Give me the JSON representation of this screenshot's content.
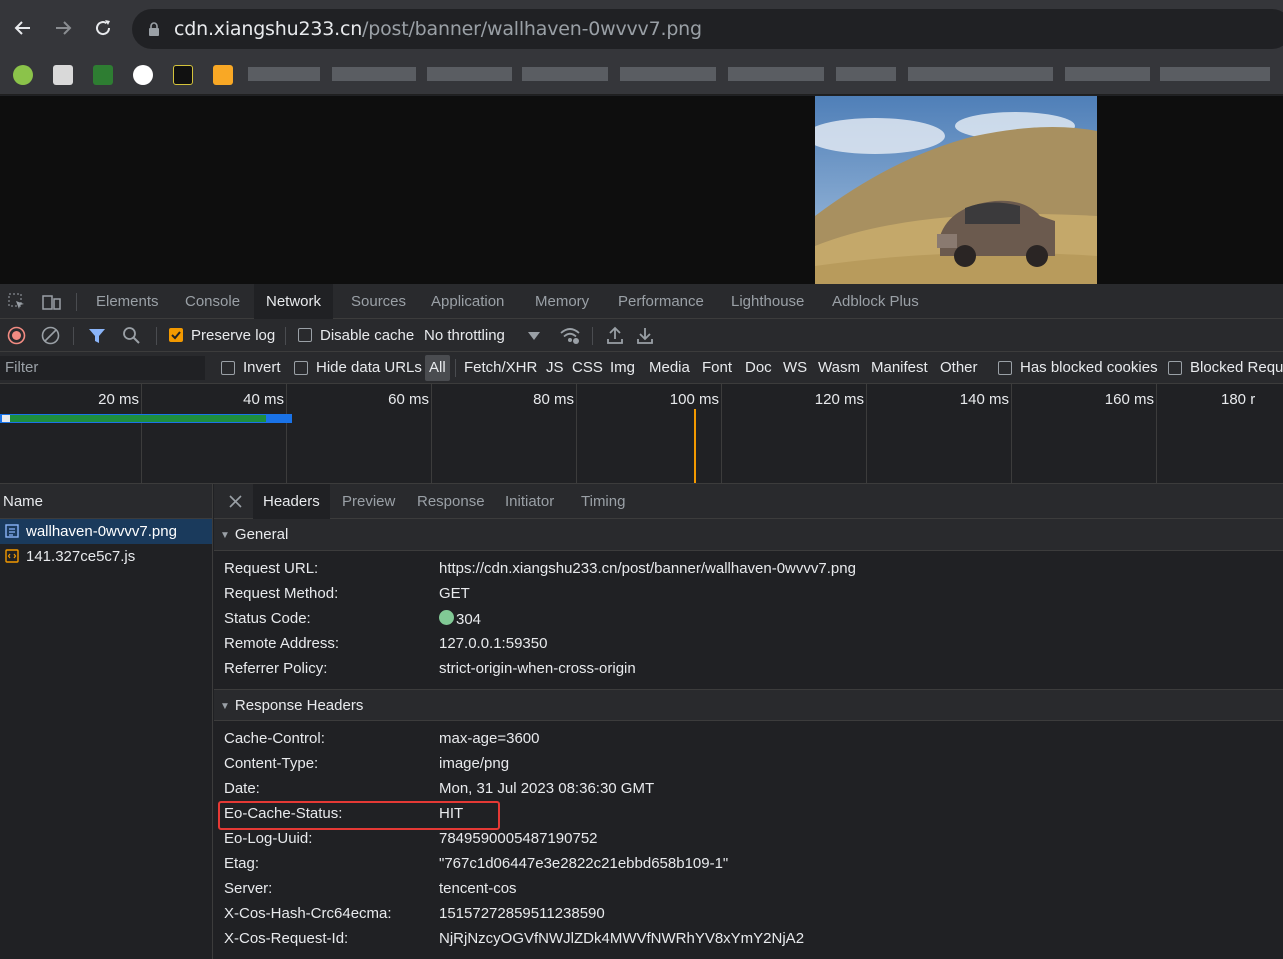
{
  "browser": {
    "url_host": "cdn.xiangshu233.cn",
    "url_path": "/post/banner/wallhaven-0wvvv7.png",
    "nav": {
      "back_icon": "back-arrow-icon",
      "forward_icon": "forward-arrow-icon",
      "reload_icon": "reload-icon"
    }
  },
  "devtools": {
    "tabs": [
      "Elements",
      "Console",
      "Network",
      "Sources",
      "Application",
      "Memory",
      "Performance",
      "Lighthouse",
      "Adblock Plus"
    ],
    "active_tab": "Network",
    "toolbar": {
      "preserve_log": "Preserve log",
      "disable_cache": "Disable cache",
      "throttling": "No throttling"
    },
    "filter": {
      "placeholder": "Filter",
      "invert": "Invert",
      "hide_data_urls": "Hide data URLs",
      "types": [
        "All",
        "Fetch/XHR",
        "JS",
        "CSS",
        "Img",
        "Media",
        "Font",
        "Doc",
        "WS",
        "Wasm",
        "Manifest",
        "Other"
      ],
      "has_blocked_cookies": "Has blocked cookies",
      "blocked_requests": "Blocked Reque"
    },
    "timeline": {
      "labels": [
        "20 ms",
        "40 ms",
        "60 ms",
        "80 ms",
        "100 ms",
        "120 ms",
        "140 ms",
        "160 ms",
        "180 r"
      ]
    },
    "requests": {
      "header": "Name",
      "items": [
        "wallhaven-0wvvv7.png",
        "141.327ce5c7.js"
      ]
    },
    "detail": {
      "tabs": [
        "Headers",
        "Preview",
        "Response",
        "Initiator",
        "Timing"
      ],
      "active_tab": "Headers",
      "general_title": "General",
      "general": {
        "request_url_k": "Request URL:",
        "request_url_v": "https://cdn.xiangshu233.cn/post/banner/wallhaven-0wvvv7.png",
        "method_k": "Request Method:",
        "method_v": "GET",
        "status_k": "Status Code:",
        "status_v": "304",
        "remote_k": "Remote Address:",
        "remote_v": "127.0.0.1:59350",
        "referrer_k": "Referrer Policy:",
        "referrer_v": "strict-origin-when-cross-origin"
      },
      "response_title": "Response Headers",
      "response": [
        {
          "k": "Cache-Control:",
          "v": "max-age=3600"
        },
        {
          "k": "Content-Type:",
          "v": "image/png"
        },
        {
          "k": "Date:",
          "v": "Mon, 31 Jul 2023 08:36:30 GMT"
        },
        {
          "k": "Eo-Cache-Status:",
          "v": "HIT"
        },
        {
          "k": "Eo-Log-Uuid:",
          "v": "7849590005487190752"
        },
        {
          "k": "Etag:",
          "v": "\"767c1d06447e3e2822c21ebbd658b109-1\""
        },
        {
          "k": "Server:",
          "v": "tencent-cos"
        },
        {
          "k": "X-Cos-Hash-Crc64ecma:",
          "v": "15157272859511238590"
        },
        {
          "k": "X-Cos-Request-Id:",
          "v": "NjRjNzcyOGVfNWJlZDk4MWVfNWRhYV8xYmY2NjA2"
        }
      ]
    }
  },
  "colors": {
    "accent": "#8ab4f8",
    "checkbox": "#f29900",
    "status_ok": "#81c995",
    "highlight": "#e53935"
  }
}
